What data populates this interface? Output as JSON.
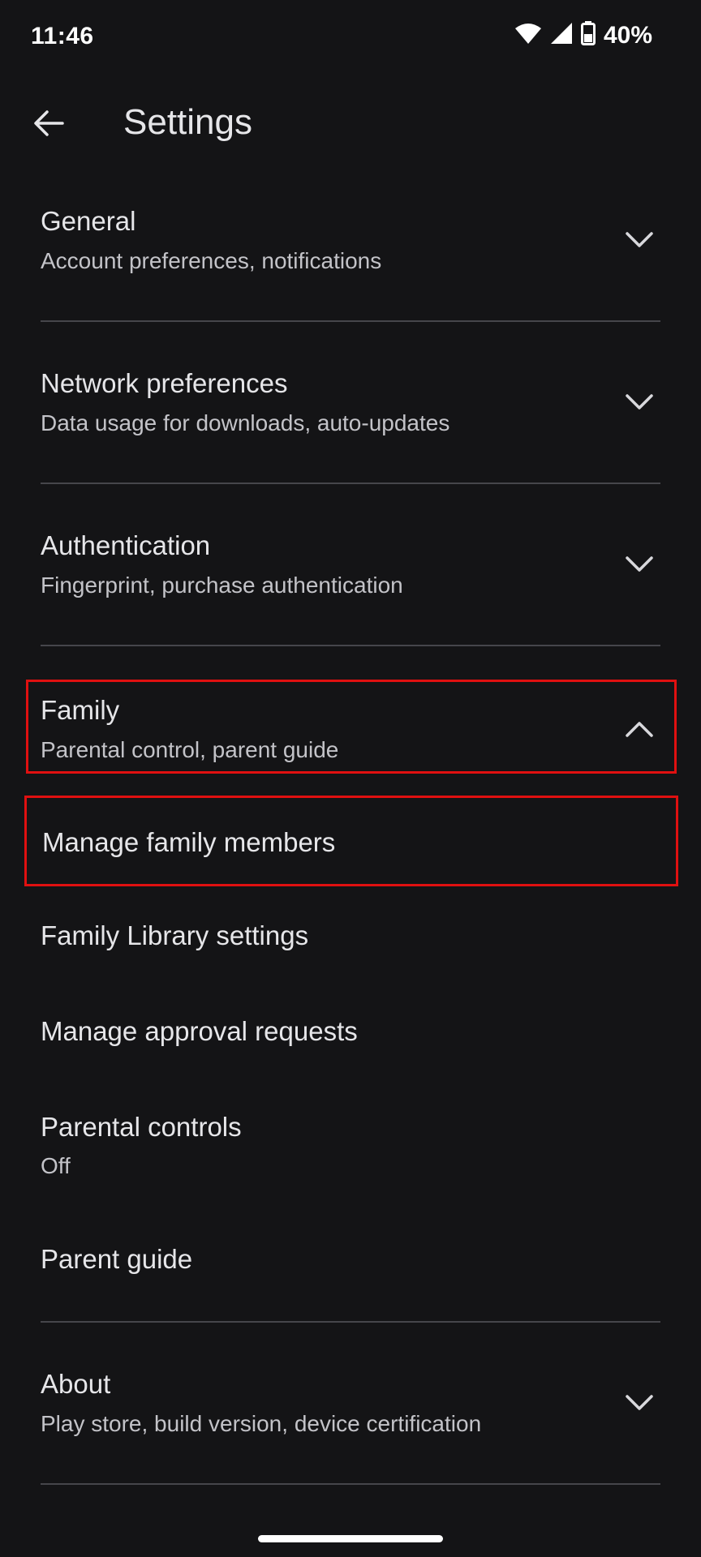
{
  "status_bar": {
    "time": "11:46",
    "battery": "40%"
  },
  "app_bar": {
    "title": "Settings"
  },
  "sections": {
    "general": {
      "title": "General",
      "subtitle": "Account preferences, notifications"
    },
    "network": {
      "title": "Network preferences",
      "subtitle": "Data usage for downloads, auto-updates"
    },
    "authentication": {
      "title": "Authentication",
      "subtitle": "Fingerprint, purchase authentication"
    },
    "family": {
      "title": "Family",
      "subtitle": "Parental control, parent guide",
      "expanded": true,
      "items": {
        "manage_members": "Manage family members",
        "library_settings": "Family Library settings",
        "approval_requests": "Manage approval requests",
        "parental_controls": {
          "title": "Parental controls",
          "value": "Off"
        },
        "parent_guide": "Parent guide"
      }
    },
    "about": {
      "title": "About",
      "subtitle": "Play store, build version, device certification"
    }
  },
  "colors": {
    "background": "#141416",
    "text_primary": "#e6e6e9",
    "text_secondary": "#c3c3c8",
    "divider": "#46464b",
    "highlight_border": "#e01010"
  }
}
